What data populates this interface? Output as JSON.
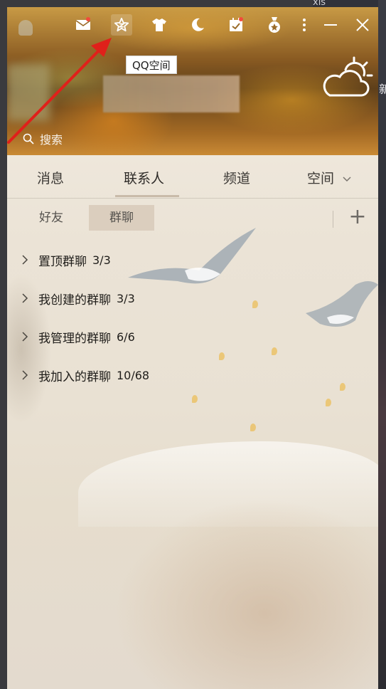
{
  "desktop": {
    "top_text": "xls",
    "side_text": "新"
  },
  "toolbar": {
    "icons": [
      {
        "name": "mail-icon",
        "has_dot": true
      },
      {
        "name": "qzone-star-icon",
        "has_dot": false,
        "active": true
      },
      {
        "name": "tshirt-icon",
        "has_dot": false
      },
      {
        "name": "moon-icon",
        "has_dot": false
      },
      {
        "name": "calendar-icon",
        "has_dot": true
      },
      {
        "name": "badge-icon",
        "has_dot": false
      },
      {
        "name": "more-icon",
        "has_dot": false
      },
      {
        "name": "minimize-icon",
        "has_dot": false
      },
      {
        "name": "close-icon",
        "has_dot": false
      }
    ],
    "tooltip": "QQ空间"
  },
  "search": {
    "placeholder": "搜索"
  },
  "tabs": {
    "messages": "消息",
    "contacts": "联系人",
    "channels": "频道",
    "space": "空间",
    "selected": "联系人"
  },
  "subtabs": {
    "friends": "好友",
    "groups": "群聊",
    "selected": "群聊",
    "add_label": "+"
  },
  "groups": [
    {
      "label": "置顶群聊",
      "count": "3/3"
    },
    {
      "label": "我创建的群聊",
      "count": "3/3"
    },
    {
      "label": "我管理的群聊",
      "count": "6/6"
    },
    {
      "label": "我加入的群聊",
      "count": "10/68"
    }
  ],
  "colors": {
    "annotation_arrow": "#e0201a",
    "notification_dot": "#f24a3c"
  }
}
